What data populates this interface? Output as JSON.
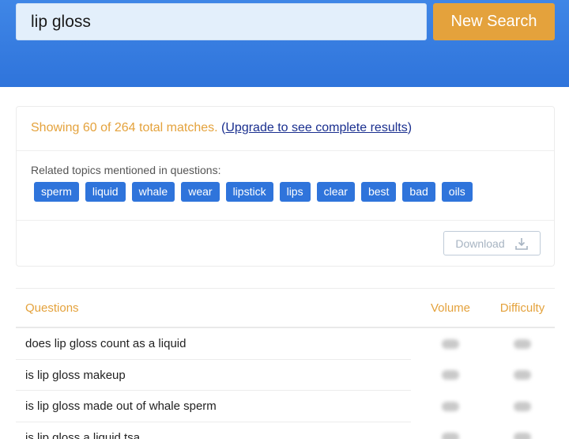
{
  "search": {
    "value": "lip gloss",
    "button_label": "New Search"
  },
  "results": {
    "match_text": "Showing 60 of 264 total matches.",
    "paren_open": "(",
    "upgrade_label": "Upgrade to see complete results",
    "paren_close": ")"
  },
  "topics": {
    "label": "Related topics mentioned in questions:",
    "tags": [
      "sperm",
      "liquid",
      "whale",
      "wear",
      "lipstick",
      "lips",
      "clear",
      "best",
      "bad",
      "oils"
    ]
  },
  "download": {
    "label": "Download",
    "icon": "download-icon"
  },
  "table": {
    "headers": {
      "question": "Questions",
      "volume": "Volume",
      "difficulty": "Difficulty"
    },
    "rows": [
      "does lip gloss count as a liquid",
      "is lip gloss makeup",
      "is lip gloss made out of whale sperm",
      "is lip gloss a liquid tsa"
    ]
  },
  "colors": {
    "header_blue": "#2f74db",
    "accent_orange": "#e4a23c",
    "tag_blue": "#2f74db",
    "link_navy": "#1a2f8f"
  }
}
